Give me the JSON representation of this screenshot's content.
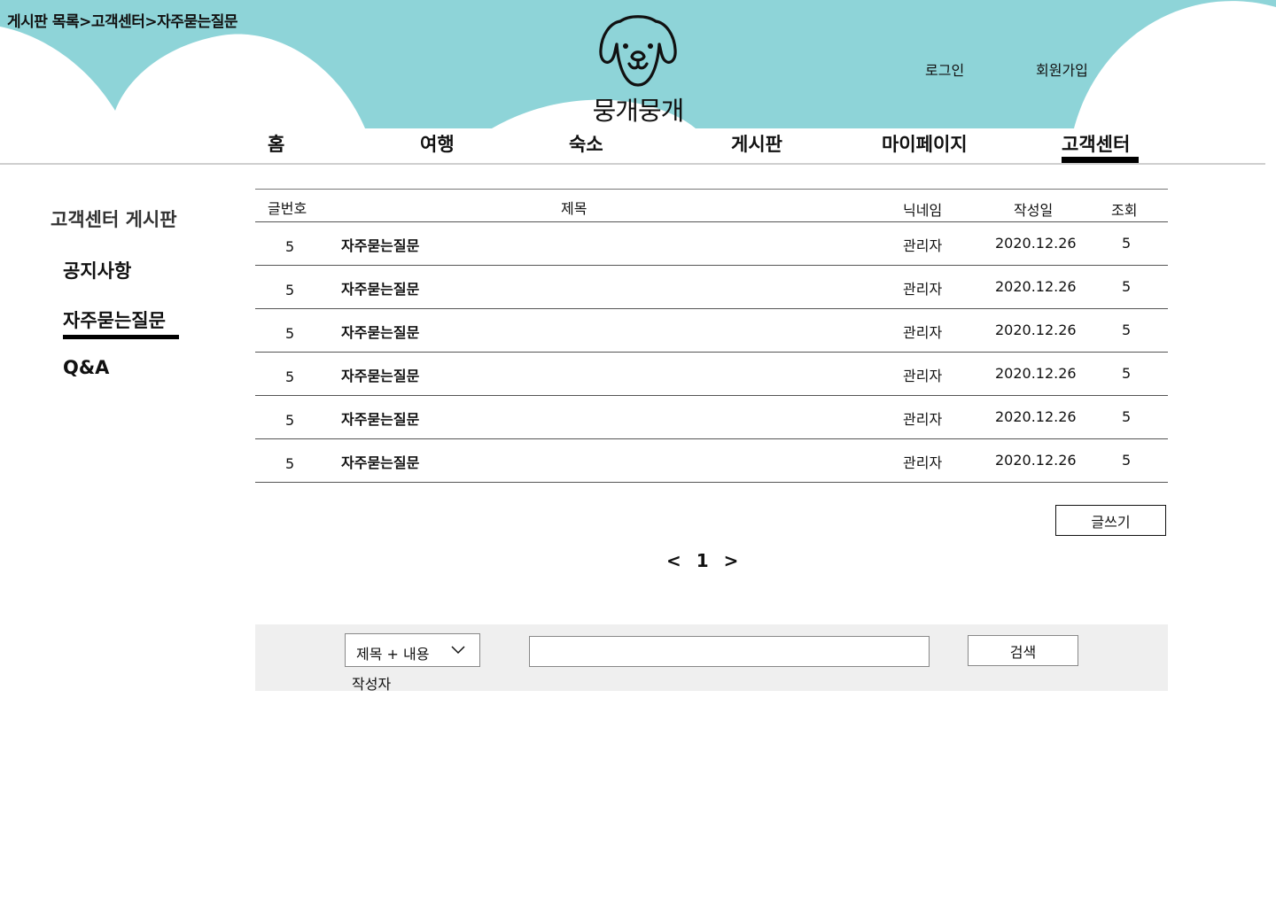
{
  "breadcrumb": "게시판 목록>고객센터>자주묻는질문",
  "logo": {
    "text": "뭉개뭉개",
    "icon": "dog-face-icon"
  },
  "auth": {
    "login": "로그인",
    "signup": "회원가입"
  },
  "nav": {
    "home": "홈",
    "travel": "여행",
    "lodging": "숙소",
    "board": "게시판",
    "mypage": "마이페이지",
    "cs": "고객센터"
  },
  "sidebar": {
    "title": "고객센터 게시판",
    "items": [
      "공지사항",
      "자주묻는질문",
      "Q&A"
    ]
  },
  "table": {
    "headers": {
      "no": "글번호",
      "title": "제목",
      "nick": "닉네임",
      "date": "작성일",
      "views": "조회"
    },
    "rows": [
      {
        "no": "5",
        "title": "자주묻는질문",
        "nick": "관리자",
        "date": "2020.12.26",
        "views": "5"
      },
      {
        "no": "5",
        "title": "자주묻는질문",
        "nick": "관리자",
        "date": "2020.12.26",
        "views": "5"
      },
      {
        "no": "5",
        "title": "자주묻는질문",
        "nick": "관리자",
        "date": "2020.12.26",
        "views": "5"
      },
      {
        "no": "5",
        "title": "자주묻는질문",
        "nick": "관리자",
        "date": "2020.12.26",
        "views": "5"
      },
      {
        "no": "5",
        "title": "자주묻는질문",
        "nick": "관리자",
        "date": "2020.12.26",
        "views": "5"
      },
      {
        "no": "5",
        "title": "자주묻는질문",
        "nick": "관리자",
        "date": "2020.12.26",
        "views": "5"
      }
    ]
  },
  "write_button": "글쓰기",
  "pagination": {
    "prev": "<",
    "current": "1",
    "next": ">"
  },
  "search": {
    "type_selected": "제목 + 내용",
    "type_option": "작성자",
    "input_value": "",
    "button": "검색"
  },
  "colors": {
    "header_bg": "#8ed4d8",
    "active_underline": "#000000",
    "search_bar_bg": "#efefef"
  }
}
